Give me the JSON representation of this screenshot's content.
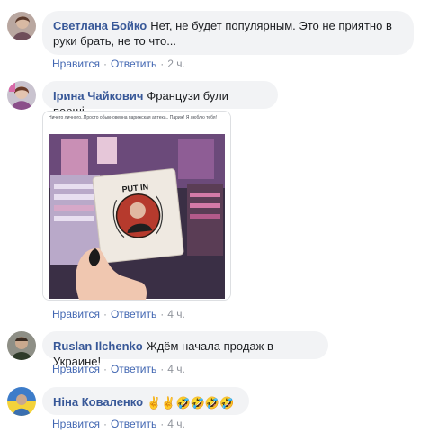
{
  "comments": [
    {
      "author": "Светлана Бойко",
      "text": "Нет, не будет популярным. Это не приятно в руки брать, не то что...",
      "text_line1": "Нет, не будет популярным. Это не приятно в",
      "text_line2": "руки брать, не то что...",
      "like": "Нравится",
      "reply": "Ответить",
      "time": "2 ч."
    },
    {
      "author": "Ірина Чайкович",
      "text": "Французи були перші...",
      "like": "Нравится",
      "reply": "Ответить",
      "time": "4 ч.",
      "attachment": {
        "caption": "Ничего личного..Просто обыкновенна парижская аптека.. Париж! Я люблю тебя!",
        "label": "PUT IN"
      }
    },
    {
      "author": "Ruslan Ilchenko",
      "text": "Ждём начала продаж в Украине!",
      "like": "Нравится",
      "reply": "Ответить",
      "time": "4 ч."
    },
    {
      "author": "Ніна Коваленко",
      "emojis": [
        "✌",
        "✌",
        "🤣",
        "🤣",
        "🤣",
        "🤣"
      ],
      "emoji_names": [
        "victory-hand-icon",
        "victory-hand-icon",
        "rofl-face-icon",
        "rofl-face-icon",
        "rofl-face-icon",
        "rofl-face-icon"
      ],
      "like": "Нравится",
      "reply": "Ответить",
      "time": "4 ч."
    }
  ],
  "separator": "·",
  "colors": {
    "author": "#385898",
    "link": "#4267b2",
    "meta": "#90949c",
    "bubble": "#f2f3f5"
  }
}
